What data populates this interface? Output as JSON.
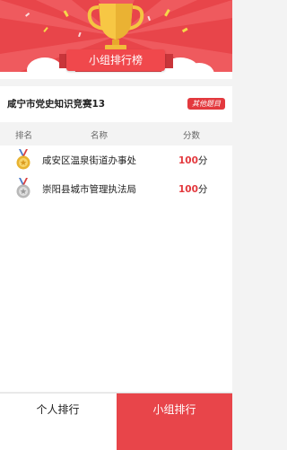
{
  "header": {
    "banner_title": "小组排行榜"
  },
  "quiz": {
    "title": "咸宁市党史知识竞赛13",
    "other_label": "其他题目"
  },
  "table": {
    "columns": [
      "排名",
      "名称",
      "分数"
    ],
    "rows": [
      {
        "medal": "gold-medal-icon",
        "name": "咸安区温泉街道办事处",
        "score": "100",
        "unit": "分"
      },
      {
        "medal": "silver-medal-icon",
        "name": "崇阳县城市管理执法局",
        "score": "100",
        "unit": "分"
      }
    ]
  },
  "tabs": {
    "personal": "个人排行",
    "group": "小组排行"
  },
  "colors": {
    "accent": "#e8454a",
    "score": "#e3393e",
    "gold": "#e8b330",
    "silver": "#b8b8b8"
  }
}
